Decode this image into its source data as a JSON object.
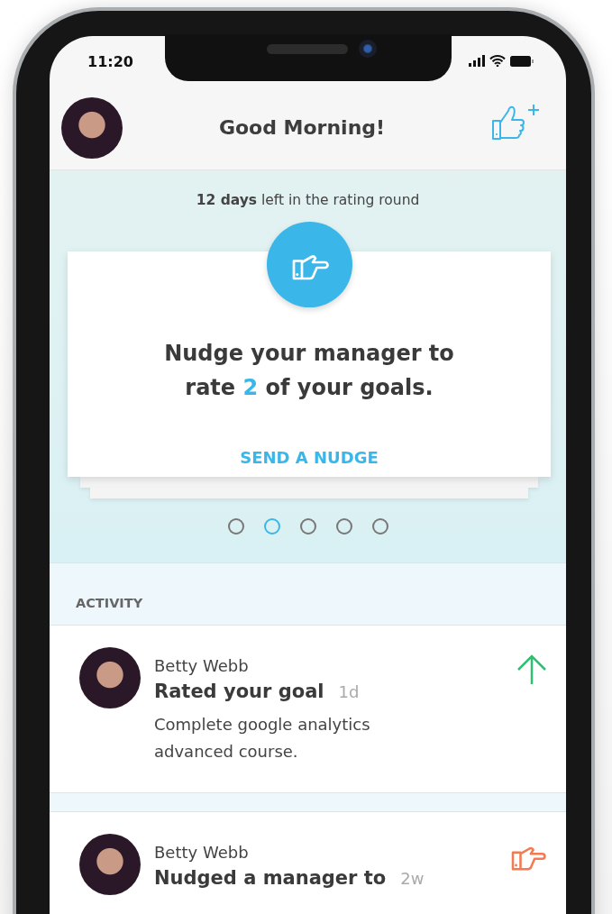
{
  "status_bar": {
    "time": "11:20"
  },
  "header": {
    "title": "Good Morning!"
  },
  "banner": {
    "countdown": "**12 days** left in the rating round",
    "card": {
      "message_start": "Nudge your manager to rate ",
      "count": "2",
      "message_end": " of your goals.",
      "action": "SEND A NUDGE"
    },
    "pager": [
      {
        "selected": false
      },
      {
        "selected": true
      },
      {
        "selected": false
      },
      {
        "selected": false
      },
      {
        "selected": false
      }
    ]
  },
  "activity": {
    "heading": "ACTIVITY",
    "items": [
      {
        "kind": "rating",
        "name": "Betty Webb",
        "action": "Rated your goal",
        "age": "1d",
        "detail": "Complete google analytics advanced course."
      },
      {
        "kind": "nudge",
        "name": "Betty Webb",
        "action": "Nudged a manager to",
        "age": "2w"
      }
    ]
  }
}
